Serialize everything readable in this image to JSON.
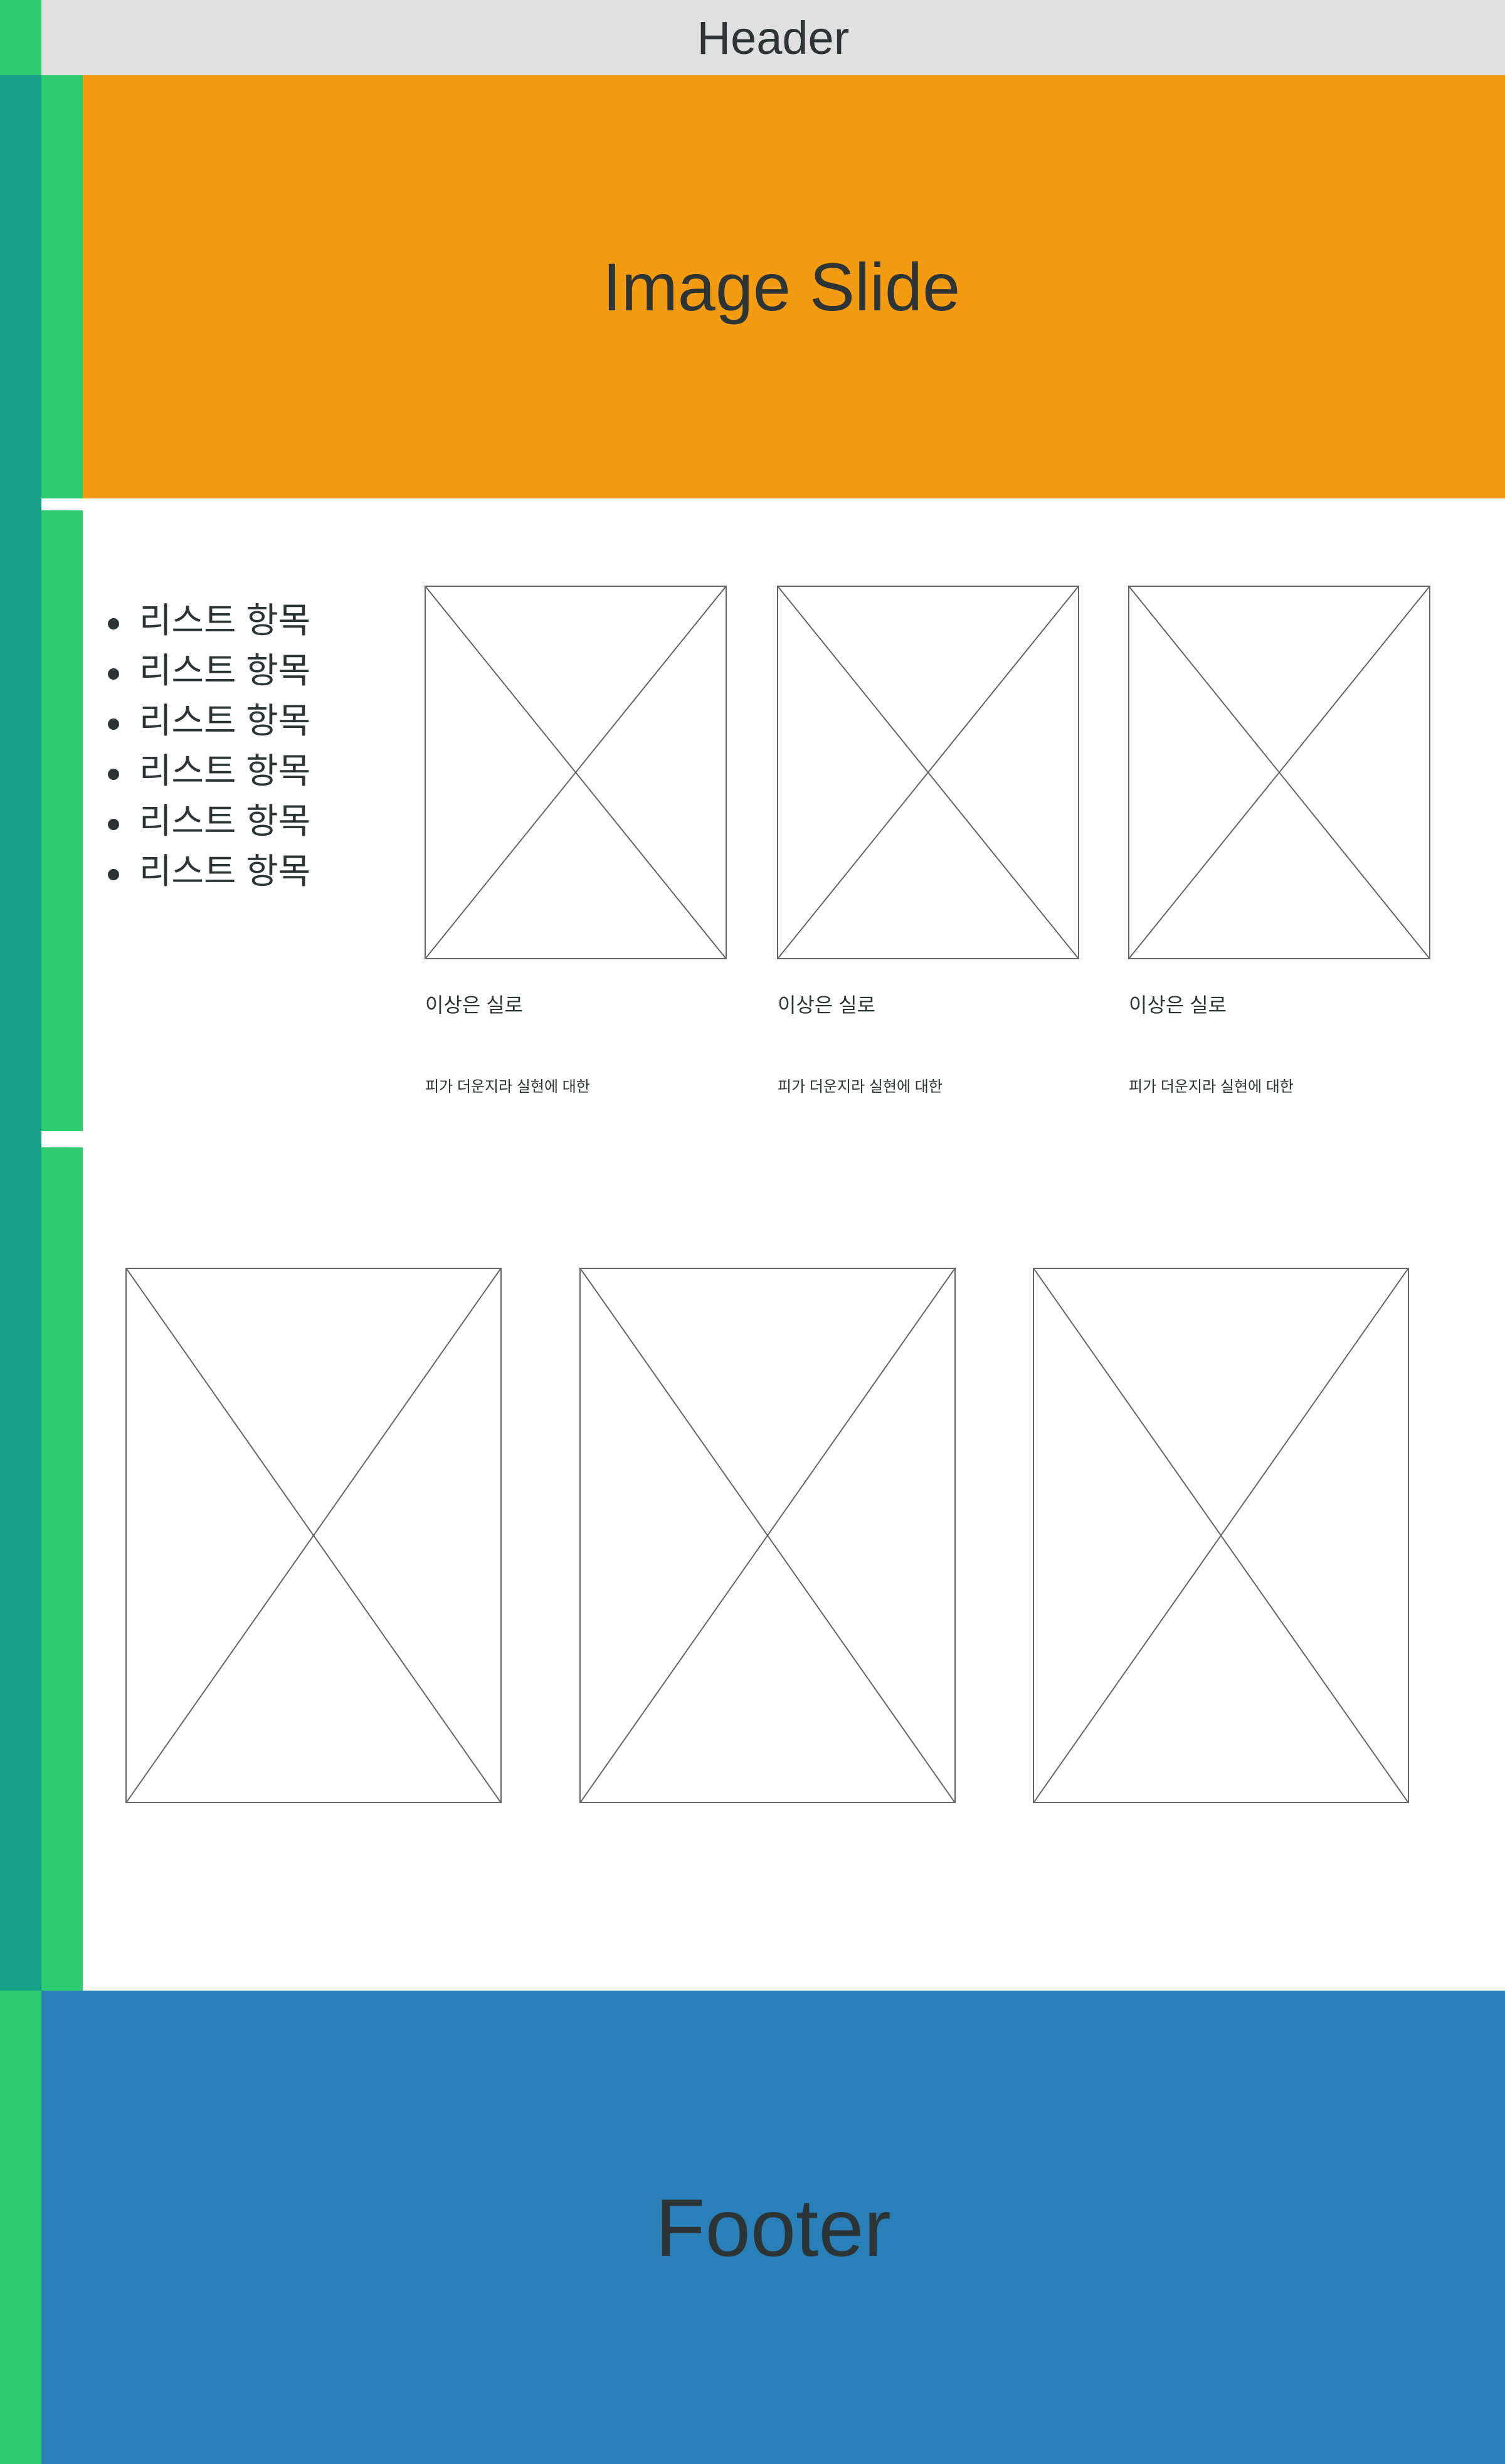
{
  "header": {
    "title": "Header"
  },
  "slide": {
    "title": "Image Slide"
  },
  "list": {
    "items": [
      "리스트 항목",
      "리스트 항목",
      "리스트 항목",
      "리스트 항목",
      "리스트 항목",
      "리스트 항목"
    ]
  },
  "cards": [
    {
      "title": "이상은 실로",
      "desc": "피가 더운지라 실현에 대한"
    },
    {
      "title": "이상은 실로",
      "desc": "피가 더운지라 실현에 대한"
    },
    {
      "title": "이상은 실로",
      "desc": "피가 더운지라 실현에 대한"
    }
  ],
  "footer": {
    "title": "Footer"
  },
  "colors": {
    "header_bg": "#e0e0e0",
    "slide_bg": "#f39c12",
    "footer_bg": "#2980b9",
    "sidebar_teal": "#16a085",
    "sidebar_green": "#2ecc71"
  }
}
